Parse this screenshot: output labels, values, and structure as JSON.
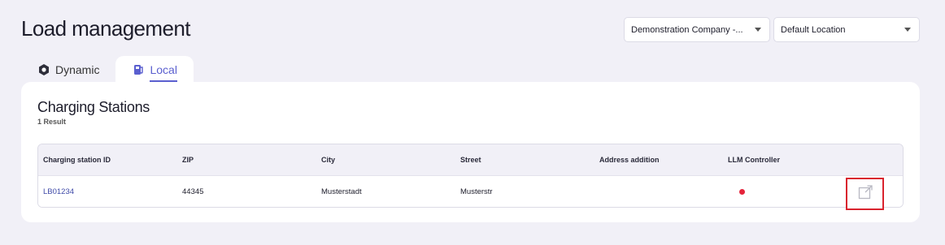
{
  "header": {
    "title": "Load management"
  },
  "filters": {
    "company": "Demonstration Company -...",
    "location": "Default Location"
  },
  "tabs": [
    {
      "label": "Dynamic",
      "icon": "gear-hex-icon",
      "active": false
    },
    {
      "label": "Local",
      "icon": "charging-station-icon",
      "active": true
    }
  ],
  "section": {
    "title": "Charging Stations",
    "result_count": "1 Result"
  },
  "table": {
    "columns": [
      "Charging station ID",
      "ZIP",
      "City",
      "Street",
      "Address addition",
      "LLM Controller"
    ],
    "rows": [
      {
        "id": "LB01234",
        "zip": "44345",
        "city": "Musterstadt",
        "street": "Musterstr",
        "address_addition": "",
        "llm_controller_status": "offline"
      }
    ]
  },
  "colors": {
    "accent": "#5a5fcf",
    "status_red": "#e5243b",
    "highlight_border": "#d9232e"
  }
}
